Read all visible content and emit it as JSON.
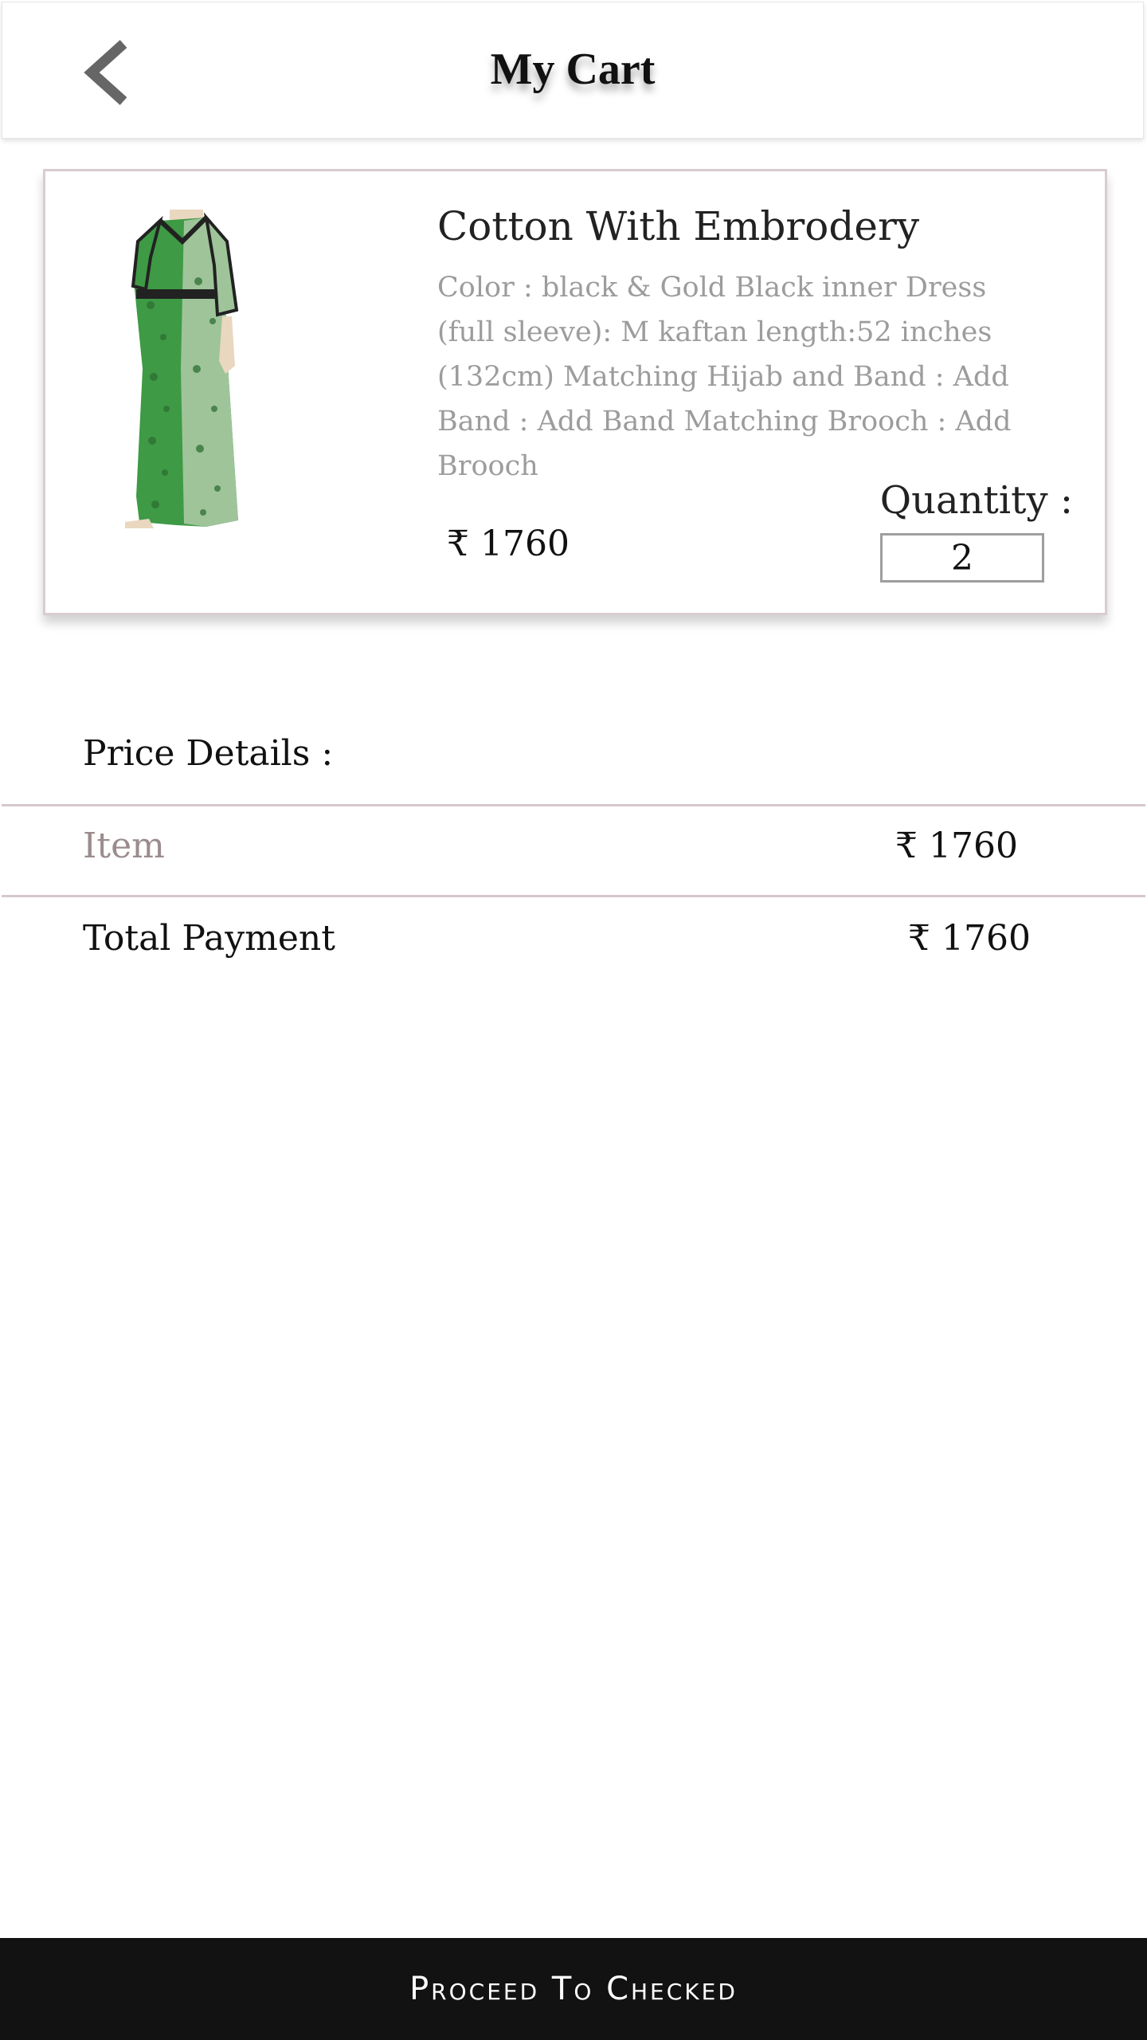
{
  "header": {
    "title": "My Cart",
    "back_icon": "chevron-left-icon"
  },
  "cart_item": {
    "name": "Cotton With Embrodery",
    "description": "Color : black & Gold Black inner Dress (full sleeve): M kaftan length:52 inches (132cm) Matching  Hijab and Band : Add  Band : Add Band Matching Brooch : Add Brooch",
    "price": "₹ 1760",
    "quantity_label": "Quantity :",
    "quantity": "2"
  },
  "price_details": {
    "heading": "Price Details :",
    "item_label": "Item",
    "item_value": "₹ 1760",
    "total_label": "Total Payment",
    "total_value": "₹ 1760"
  },
  "checkout": {
    "label": "Proceed To Checked"
  },
  "colors": {
    "divider": "#d6c8cb",
    "muted_text": "#9c9c9c",
    "item_label": "#9b8c8c",
    "bottom_bar": "#121212"
  }
}
